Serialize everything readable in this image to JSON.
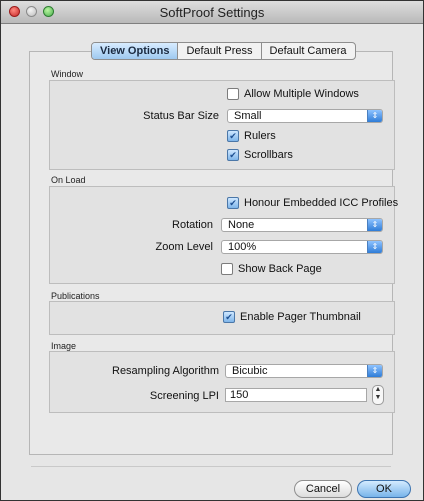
{
  "window": {
    "title": "SoftProof Settings"
  },
  "tabs": [
    {
      "label": "View Options",
      "active": true
    },
    {
      "label": "Default Press",
      "active": false
    },
    {
      "label": "Default Camera",
      "active": false
    }
  ],
  "sections": {
    "window": {
      "label": "Window",
      "allow_multiple_windows": {
        "label": "Allow Multiple Windows",
        "checked": false
      },
      "status_bar_size": {
        "label": "Status Bar Size",
        "value": "Small"
      },
      "rulers": {
        "label": "Rulers",
        "checked": true
      },
      "scrollbars": {
        "label": "Scrollbars",
        "checked": true
      }
    },
    "on_load": {
      "label": "On Load",
      "honour_icc": {
        "label": "Honour Embedded ICC Profiles",
        "checked": true
      },
      "rotation": {
        "label": "Rotation",
        "value": "None"
      },
      "zoom_level": {
        "label": "Zoom Level",
        "value": "100%"
      },
      "show_back_page": {
        "label": "Show Back Page",
        "checked": false
      }
    },
    "publications": {
      "label": "Publications",
      "enable_pager_thumbnail": {
        "label": "Enable Pager Thumbnail",
        "checked": true
      }
    },
    "image": {
      "label": "Image",
      "resampling_algorithm": {
        "label": "Resampling Algorithm",
        "value": "Bicubic"
      },
      "screening_lpi": {
        "label": "Screening LPI",
        "value": "150"
      }
    }
  },
  "buttons": {
    "cancel": "Cancel",
    "ok": "OK"
  },
  "colors": {
    "accent": "#2e7cd7",
    "window_bg": "#e6e6e6"
  }
}
